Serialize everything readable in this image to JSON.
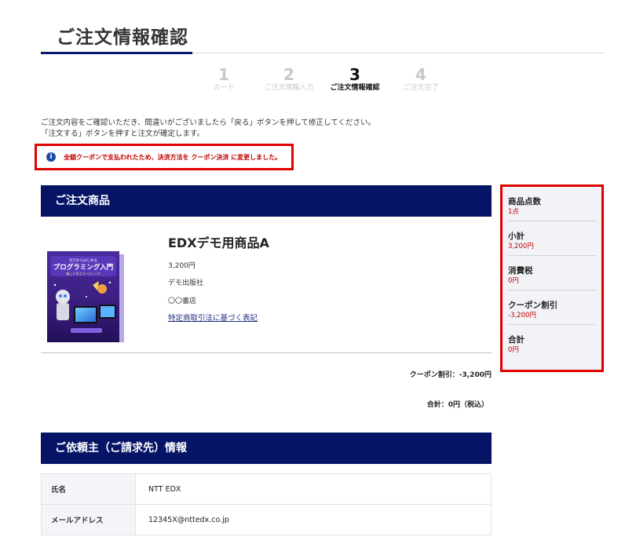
{
  "page": {
    "title": "ご注文情報確認"
  },
  "steps": [
    {
      "num": "1",
      "label": "カート"
    },
    {
      "num": "2",
      "label": "ご注文情報入力"
    },
    {
      "num": "3",
      "label": "ご注文情報確認"
    },
    {
      "num": "4",
      "label": "ご注文完了"
    }
  ],
  "notice": {
    "line1": "ご注文内容をご確認いただき、間違いがございましたら「戻る」ボタンを押して修正してください。",
    "line2": "「注文する」ボタンを押すと注文が確定します。"
  },
  "alert": {
    "text": "全額クーポンで支払われたため、決済方法を クーポン決済 に変更しました。"
  },
  "order_section": {
    "heading": "ご注文商品",
    "product": {
      "name": "EDXデモ用商品A",
      "price": "3,200円",
      "publisher": "デモ出版社",
      "store": "〇〇書店",
      "legal_link": "特定商取引法に基づく表記",
      "cover": {
        "top_text": "ゼロからはじめる",
        "title": "プログラミング入門",
        "subtitle": "楽しく学ぶコーディング"
      }
    },
    "coupon_discount": "クーポン割引：-3,200円",
    "total": "合計：0円（税込）"
  },
  "billing_section": {
    "heading": "ご依頼主（ご請求先）情報",
    "rows": [
      {
        "label": "氏名",
        "value": "NTT EDX"
      },
      {
        "label": "メールアドレス",
        "value": "12345X@nttedx.co.jp"
      }
    ]
  },
  "summary": {
    "items": [
      {
        "label": "商品点数",
        "value": "1点"
      },
      {
        "label": "小計",
        "value": "3,200円"
      },
      {
        "label": "消費税",
        "value": "0円"
      },
      {
        "label": "クーポン割引",
        "value": "-3,200円"
      },
      {
        "label": "合計",
        "value": "0円"
      }
    ]
  },
  "colors": {
    "navy": "#061466",
    "alert_red": "#e00000",
    "price_red": "#c00000",
    "info_blue": "#1f4aa8"
  },
  "icons": {
    "alert_icon": "info-icon"
  }
}
